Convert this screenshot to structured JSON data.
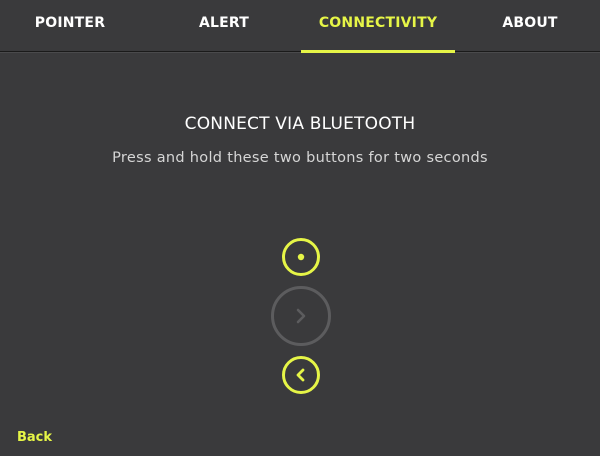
{
  "tabs": [
    {
      "label": "POINTER",
      "active": false
    },
    {
      "label": "ALERT",
      "active": false
    },
    {
      "label": "CONNECTIVITY",
      "active": true
    },
    {
      "label": "ABOUT",
      "active": false
    }
  ],
  "main": {
    "title": "CONNECT VIA BLUETOOTH",
    "subtitle": "Press and hold these two buttons for two seconds",
    "buttons": [
      {
        "icon": "dot-icon",
        "highlighted": true
      },
      {
        "icon": "chevron-right-icon",
        "highlighted": false
      },
      {
        "icon": "chevron-left-icon",
        "highlighted": true
      }
    ]
  },
  "footer": {
    "back_label": "Back"
  },
  "colors": {
    "background": "#3a3a3c",
    "accent": "#e6f547",
    "inactive": "#5c5c5e",
    "text": "#ffffff",
    "subtext": "#d6d6d6"
  }
}
